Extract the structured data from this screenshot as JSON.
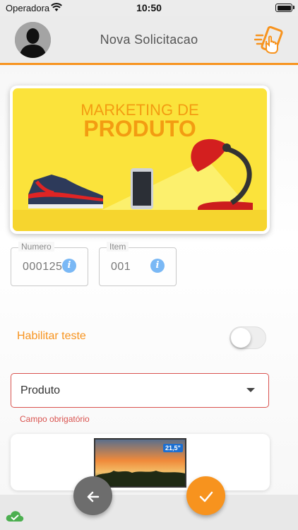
{
  "status_bar": {
    "carrier": "Operadora",
    "time": "10:50",
    "wifi_icon": "wifi-icon",
    "battery_icon": "battery-icon"
  },
  "header": {
    "title": "Nova Solicitacao",
    "avatar_icon": "user-silhouette-icon",
    "action_icon": "tap-phone-icon"
  },
  "banner": {
    "line1": "MARKETING DE",
    "line2": "PRODUTO",
    "background_color": "#fbe33b",
    "accent_color": "#f39c12"
  },
  "fields": [
    {
      "label": "Numero",
      "value": "000125",
      "icon": "info-icon"
    },
    {
      "label": "Item",
      "value": "001",
      "icon": "info-icon"
    }
  ],
  "toggle": {
    "label": "Habilitar teste",
    "state": "off"
  },
  "select": {
    "value": "Produto",
    "error": "Campo obrigatório",
    "error_color": "#d9534f"
  },
  "product_preview": {
    "badge": "21,5\""
  },
  "actions": {
    "back_icon": "arrow-left-icon",
    "confirm_icon": "check-icon",
    "sync_icon": "cloud-check-icon"
  },
  "colors": {
    "accent": "#f7931e",
    "info": "#7ab8f5"
  }
}
